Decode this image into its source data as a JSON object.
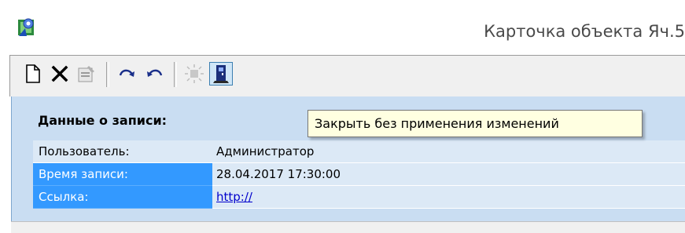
{
  "window": {
    "title": "Карточка объекта Яч.5"
  },
  "toolbar": {
    "buttons": [
      {
        "name": "new-document-icon",
        "tooltip": ""
      },
      {
        "name": "delete-icon",
        "tooltip": ""
      },
      {
        "name": "properties-icon",
        "tooltip": ""
      },
      {
        "name": "redo-icon",
        "tooltip": ""
      },
      {
        "name": "undo-icon",
        "tooltip": ""
      },
      {
        "name": "apply-icon",
        "tooltip": ""
      },
      {
        "name": "close-discard-icon",
        "tooltip": ""
      }
    ],
    "tooltip_text": "Закрыть без применения изменений"
  },
  "record": {
    "section_title": "Данные о записи:",
    "rows": [
      {
        "label": "Пользователь:",
        "value": "Администратор",
        "selected": false,
        "link": false
      },
      {
        "label": "Время записи:",
        "value": "28.04.2017 17:30:00",
        "selected": true,
        "link": false
      },
      {
        "label": "Ссылка:",
        "value": "http://",
        "selected": true,
        "link": true
      }
    ]
  },
  "colors": {
    "panel_bg": "#c9ddf2",
    "selection": "#3399ff",
    "tooltip_bg": "#ffffe1",
    "link": "#0000cc"
  }
}
